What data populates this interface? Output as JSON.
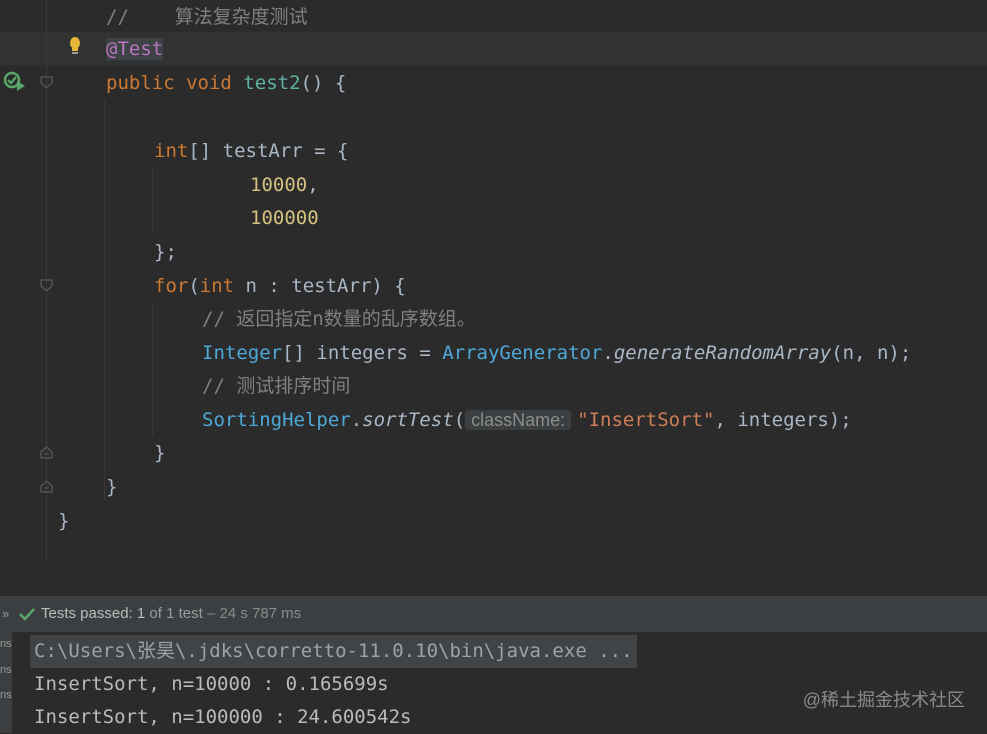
{
  "editor": {
    "line1": {
      "comment": "//    算法复杂度测试"
    },
    "line2": {
      "annotation": "@Test"
    },
    "line3": {
      "kw_public": "public",
      "kw_void": "void",
      "method": "test2",
      "rest": "() {"
    },
    "line5": {
      "kw_int": "int",
      "rest": "[] testArr = {"
    },
    "line6": {
      "num": "10000",
      "rest": ","
    },
    "line7": {
      "num": "100000"
    },
    "line8": {
      "text": "};"
    },
    "line9": {
      "kw_for": "for",
      "paren": "(",
      "kw_int": "int",
      "rest": " n : testArr) {"
    },
    "line10": {
      "comment": "// 返回指定n数量的乱序数组。"
    },
    "line11": {
      "cls1": "Integer",
      "mid": "[] integers = ",
      "cls2": "ArrayGenerator",
      "dot": ".",
      "method": "generateRandomArray",
      "args": "(n, n);"
    },
    "line12": {
      "comment": "// 测试排序时间"
    },
    "line13": {
      "cls": "SortingHelper",
      "dot": ".",
      "method": "sortTest",
      "open": "(",
      "hint": "className:",
      "str": "\"InsertSort\"",
      "rest": ", integers);"
    },
    "line14": {
      "text": "}"
    },
    "line15": {
      "text": "}"
    },
    "line16": {
      "text": "}"
    }
  },
  "test_status": {
    "prefix": "Tests passed:",
    "count": "1",
    "of": "of 1 test",
    "duration": "– 24 s 787 ms",
    "side_labels": [
      "ns",
      "ns",
      "ns"
    ]
  },
  "console": {
    "command": "C:\\Users\\张昊\\.jdks\\corretto-11.0.10\\bin\\java.exe ...",
    "out1": "InsertSort, n=10000 : 0.165699s",
    "out2": "InsertSort, n=100000 : 24.600542s"
  },
  "watermark": "@稀土掘金技术社区",
  "colors": {
    "bg": "#2b2b2b",
    "keyword": "#cc7832",
    "string": "#ce7e58",
    "number": "#d4c180",
    "pass": "#59a869"
  },
  "icons": [
    "lightbulb-icon",
    "run-test-icon",
    "fold-marker-icon",
    "check-icon",
    "expand-arrows-icon"
  ]
}
